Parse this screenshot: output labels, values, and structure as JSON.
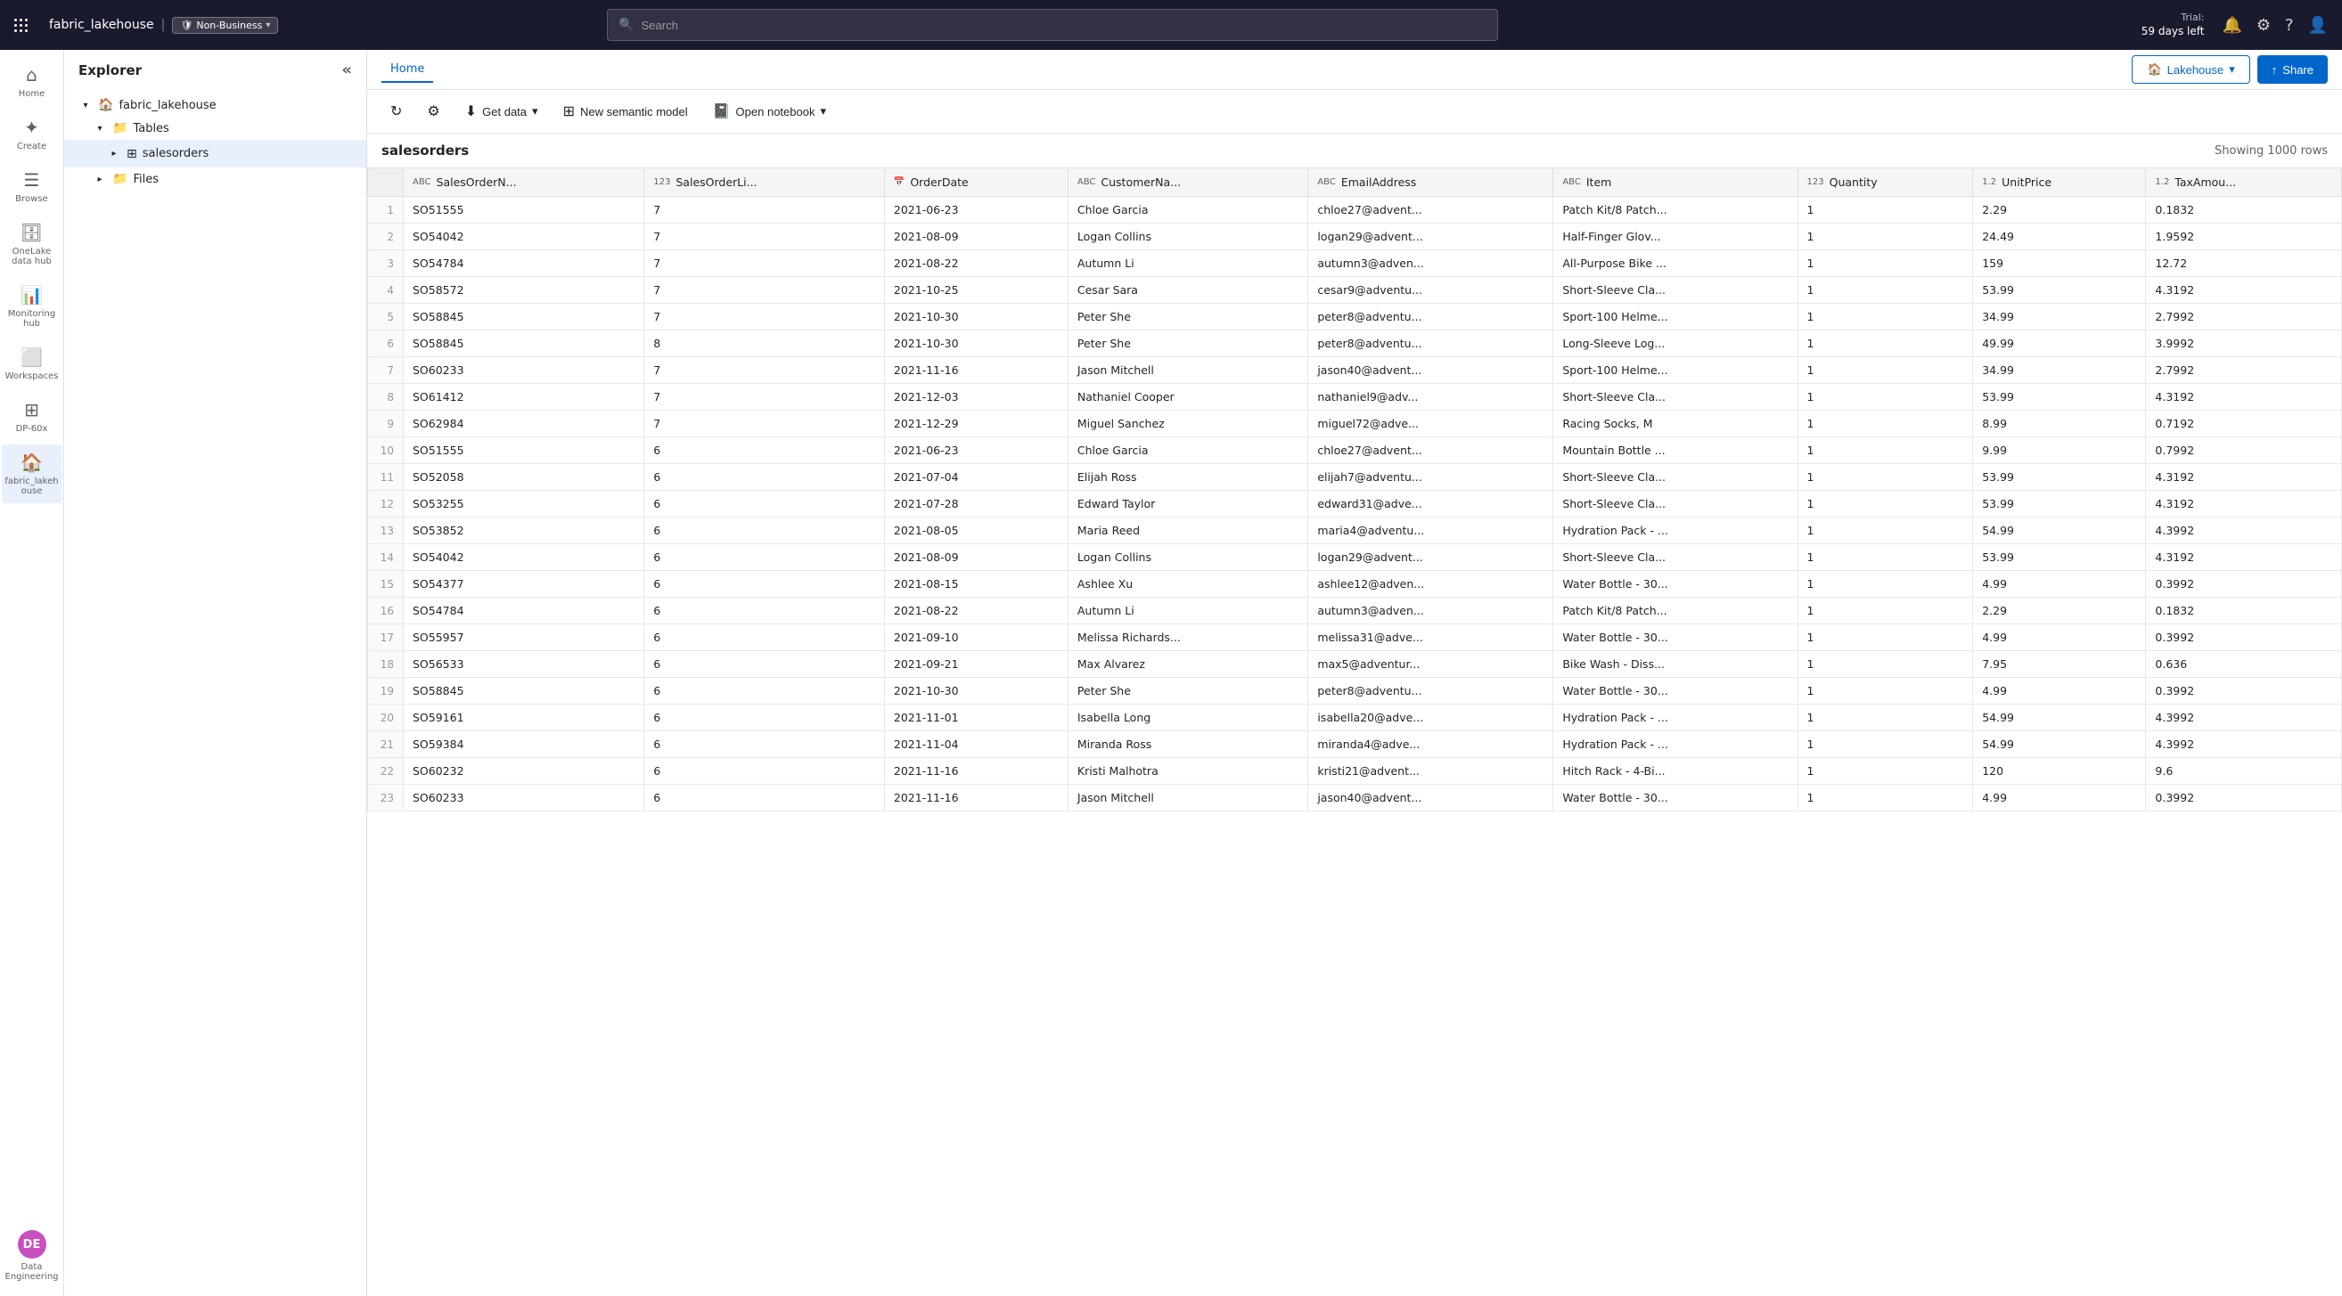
{
  "topnav": {
    "brand": "fabric_lakehouse",
    "sensitivity": "Non-Business",
    "search_placeholder": "Search",
    "trial_label": "Trial:",
    "trial_days": "59 days left"
  },
  "ribbon": {
    "active_tab": "Home",
    "tabs": [
      "Home"
    ],
    "actions": {
      "get_data": "Get data",
      "new_semantic_model": "New semantic model",
      "open_notebook": "Open notebook"
    },
    "lakehouse_label": "Lakehouse",
    "share_label": "Share"
  },
  "explorer": {
    "title": "Explorer",
    "root": "fabric_lakehouse",
    "tables_label": "Tables",
    "selected_table": "salesorders",
    "files_label": "Files"
  },
  "grid": {
    "table_name": "salesorders",
    "showing": "Showing 1000 rows",
    "columns": [
      {
        "name": "SalesOrderN...",
        "type": "ABC"
      },
      {
        "name": "SalesOrderLi...",
        "type": "123"
      },
      {
        "name": "OrderDate",
        "type": "date"
      },
      {
        "name": "CustomerNa...",
        "type": "ABC"
      },
      {
        "name": "EmailAddress",
        "type": "ABC"
      },
      {
        "name": "Item",
        "type": "ABC"
      },
      {
        "name": "Quantity",
        "type": "123"
      },
      {
        "name": "UnitPrice",
        "type": "1.2"
      },
      {
        "name": "TaxAmou...",
        "type": "1.2"
      }
    ],
    "rows": [
      [
        1,
        "SO51555",
        "7",
        "2021-06-23",
        "Chloe Garcia",
        "chloe27@advent...",
        "Patch Kit/8 Patch...",
        "1",
        "2.29",
        "0.1832"
      ],
      [
        2,
        "SO54042",
        "7",
        "2021-08-09",
        "Logan Collins",
        "logan29@advent...",
        "Half-Finger Glov...",
        "1",
        "24.49",
        "1.9592"
      ],
      [
        3,
        "SO54784",
        "7",
        "2021-08-22",
        "Autumn Li",
        "autumn3@adven...",
        "All-Purpose Bike ...",
        "1",
        "159",
        "12.72"
      ],
      [
        4,
        "SO58572",
        "7",
        "2021-10-25",
        "Cesar Sara",
        "cesar9@adventu...",
        "Short-Sleeve Cla...",
        "1",
        "53.99",
        "4.3192"
      ],
      [
        5,
        "SO58845",
        "7",
        "2021-10-30",
        "Peter She",
        "peter8@adventu...",
        "Sport-100 Helme...",
        "1",
        "34.99",
        "2.7992"
      ],
      [
        6,
        "SO58845",
        "8",
        "2021-10-30",
        "Peter She",
        "peter8@adventu...",
        "Long-Sleeve Log...",
        "1",
        "49.99",
        "3.9992"
      ],
      [
        7,
        "SO60233",
        "7",
        "2021-11-16",
        "Jason Mitchell",
        "jason40@advent...",
        "Sport-100 Helme...",
        "1",
        "34.99",
        "2.7992"
      ],
      [
        8,
        "SO61412",
        "7",
        "2021-12-03",
        "Nathaniel Cooper",
        "nathaniel9@adv...",
        "Short-Sleeve Cla...",
        "1",
        "53.99",
        "4.3192"
      ],
      [
        9,
        "SO62984",
        "7",
        "2021-12-29",
        "Miguel Sanchez",
        "miguel72@adve...",
        "Racing Socks, M",
        "1",
        "8.99",
        "0.7192"
      ],
      [
        10,
        "SO51555",
        "6",
        "2021-06-23",
        "Chloe Garcia",
        "chloe27@advent...",
        "Mountain Bottle ...",
        "1",
        "9.99",
        "0.7992"
      ],
      [
        11,
        "SO52058",
        "6",
        "2021-07-04",
        "Elijah Ross",
        "elijah7@adventu...",
        "Short-Sleeve Cla...",
        "1",
        "53.99",
        "4.3192"
      ],
      [
        12,
        "SO53255",
        "6",
        "2021-07-28",
        "Edward Taylor",
        "edward31@adve...",
        "Short-Sleeve Cla...",
        "1",
        "53.99",
        "4.3192"
      ],
      [
        13,
        "SO53852",
        "6",
        "2021-08-05",
        "Maria Reed",
        "maria4@adventu...",
        "Hydration Pack - ...",
        "1",
        "54.99",
        "4.3992"
      ],
      [
        14,
        "SO54042",
        "6",
        "2021-08-09",
        "Logan Collins",
        "logan29@advent...",
        "Short-Sleeve Cla...",
        "1",
        "53.99",
        "4.3192"
      ],
      [
        15,
        "SO54377",
        "6",
        "2021-08-15",
        "Ashlee Xu",
        "ashlee12@adven...",
        "Water Bottle - 30...",
        "1",
        "4.99",
        "0.3992"
      ],
      [
        16,
        "SO54784",
        "6",
        "2021-08-22",
        "Autumn Li",
        "autumn3@adven...",
        "Patch Kit/8 Patch...",
        "1",
        "2.29",
        "0.1832"
      ],
      [
        17,
        "SO55957",
        "6",
        "2021-09-10",
        "Melissa Richards...",
        "melissa31@adve...",
        "Water Bottle - 30...",
        "1",
        "4.99",
        "0.3992"
      ],
      [
        18,
        "SO56533",
        "6",
        "2021-09-21",
        "Max Alvarez",
        "max5@adventur...",
        "Bike Wash - Diss...",
        "1",
        "7.95",
        "0.636"
      ],
      [
        19,
        "SO58845",
        "6",
        "2021-10-30",
        "Peter She",
        "peter8@adventu...",
        "Water Bottle - 30...",
        "1",
        "4.99",
        "0.3992"
      ],
      [
        20,
        "SO59161",
        "6",
        "2021-11-01",
        "Isabella Long",
        "isabella20@adve...",
        "Hydration Pack - ...",
        "1",
        "54.99",
        "4.3992"
      ],
      [
        21,
        "SO59384",
        "6",
        "2021-11-04",
        "Miranda Ross",
        "miranda4@adve...",
        "Hydration Pack - ...",
        "1",
        "54.99",
        "4.3992"
      ],
      [
        22,
        "SO60232",
        "6",
        "2021-11-16",
        "Kristi Malhotra",
        "kristi21@advent...",
        "Hitch Rack - 4-Bi...",
        "1",
        "120",
        "9.6"
      ],
      [
        23,
        "SO60233",
        "6",
        "2021-11-16",
        "Jason Mitchell",
        "jason40@advent...",
        "Water Bottle - 30...",
        "1",
        "4.99",
        "0.3992"
      ]
    ]
  },
  "sidebar_items": [
    {
      "id": "home",
      "label": "Home",
      "icon": "⌂"
    },
    {
      "id": "create",
      "label": "Create",
      "icon": "+"
    },
    {
      "id": "browse",
      "label": "Browse",
      "icon": "☰"
    },
    {
      "id": "onelake",
      "label": "OneLake data hub",
      "icon": "🗄"
    },
    {
      "id": "monitoring",
      "label": "Monitoring hub",
      "icon": "📊"
    },
    {
      "id": "workspaces",
      "label": "Workspaces",
      "icon": "⬜"
    },
    {
      "id": "dp60x",
      "label": "DP-60x",
      "icon": "⊞"
    },
    {
      "id": "fabric_lakehouse",
      "label": "fabric_lakeh ouse",
      "icon": "🏠",
      "active": true
    },
    {
      "id": "data_engineering",
      "label": "Data Engineering",
      "icon": "⚙"
    }
  ]
}
